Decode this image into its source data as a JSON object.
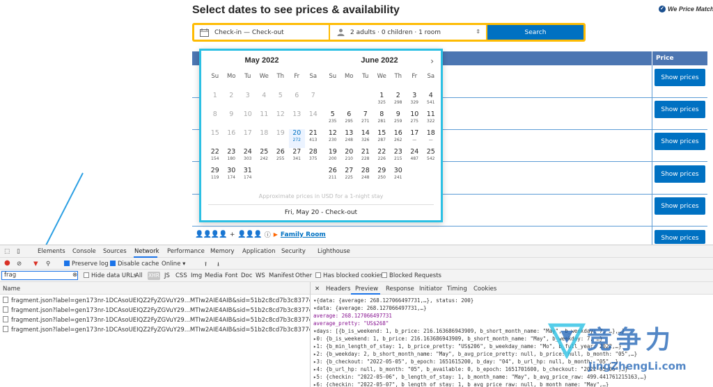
{
  "page": {
    "title": "Select dates to see prices & availability",
    "badge": "We Price Match"
  },
  "search": {
    "dates_label": "Check-in — Check-out",
    "guests_label": "2 adults · 0 children · 1 room",
    "button": "Search"
  },
  "table": {
    "price_header": "Price",
    "show_prices": [
      "Show prices",
      "Show prices",
      "Show prices",
      "Show prices",
      "Show prices",
      "Show prices"
    ],
    "family_room": "Family Room"
  },
  "calendar": {
    "day_names": [
      "Su",
      "Mo",
      "Tu",
      "We",
      "Th",
      "Fr",
      "Sa"
    ],
    "months": [
      {
        "title": "May 2022",
        "weeks": [
          [
            {
              "d": "1",
              "dis": true
            },
            {
              "d": "2",
              "dis": true
            },
            {
              "d": "3",
              "dis": true
            },
            {
              "d": "4",
              "dis": true
            },
            {
              "d": "5",
              "dis": true
            },
            {
              "d": "6",
              "dis": true
            },
            {
              "d": "7",
              "dis": true
            }
          ],
          [
            {
              "d": "8",
              "dis": true
            },
            {
              "d": "9",
              "dis": true
            },
            {
              "d": "10",
              "dis": true
            },
            {
              "d": "11",
              "dis": true
            },
            {
              "d": "12",
              "dis": true
            },
            {
              "d": "13",
              "dis": true
            },
            {
              "d": "14",
              "dis": true
            }
          ],
          [
            {
              "d": "15",
              "dis": true
            },
            {
              "d": "16",
              "dis": true
            },
            {
              "d": "17",
              "dis": true
            },
            {
              "d": "18",
              "dis": true
            },
            {
              "d": "19",
              "dis": true
            },
            {
              "d": "20",
              "p": "272",
              "sel": true
            },
            {
              "d": "21",
              "p": "413"
            }
          ],
          [
            {
              "d": "22",
              "p": "154"
            },
            {
              "d": "23",
              "p": "180"
            },
            {
              "d": "24",
              "p": "303"
            },
            {
              "d": "25",
              "p": "242"
            },
            {
              "d": "26",
              "p": "255"
            },
            {
              "d": "27",
              "p": "341"
            },
            {
              "d": "28",
              "p": "375"
            }
          ],
          [
            {
              "d": "29",
              "p": "119"
            },
            {
              "d": "30",
              "p": "174"
            },
            {
              "d": "31",
              "p": "174"
            },
            {},
            {},
            {},
            {}
          ]
        ]
      },
      {
        "title": "June 2022",
        "weeks": [
          [
            {},
            {},
            {},
            {
              "d": "1",
              "p": "325"
            },
            {
              "d": "2",
              "p": "298"
            },
            {
              "d": "3",
              "p": "329"
            },
            {
              "d": "4",
              "p": "541"
            }
          ],
          [
            {
              "d": "5",
              "p": "235"
            },
            {
              "d": "6",
              "p": "295"
            },
            {
              "d": "7",
              "p": "271"
            },
            {
              "d": "8",
              "p": "281"
            },
            {
              "d": "9",
              "p": "259"
            },
            {
              "d": "10",
              "p": "275"
            },
            {
              "d": "11",
              "p": "322"
            }
          ],
          [
            {
              "d": "12",
              "p": "230"
            },
            {
              "d": "13",
              "p": "248"
            },
            {
              "d": "14",
              "p": "326"
            },
            {
              "d": "15",
              "p": "287"
            },
            {
              "d": "16",
              "p": "262"
            },
            {
              "d": "17",
              "p": "—"
            },
            {
              "d": "18",
              "p": "—"
            }
          ],
          [
            {
              "d": "19",
              "p": "200"
            },
            {
              "d": "20",
              "p": "210"
            },
            {
              "d": "21",
              "p": "228"
            },
            {
              "d": "22",
              "p": "226"
            },
            {
              "d": "23",
              "p": "215"
            },
            {
              "d": "24",
              "p": "487"
            },
            {
              "d": "25",
              "p": "542"
            }
          ],
          [
            {
              "d": "26",
              "p": "211"
            },
            {
              "d": "27",
              "p": "225"
            },
            {
              "d": "28",
              "p": "248"
            },
            {
              "d": "29",
              "p": "250"
            },
            {
              "d": "30",
              "p": "241"
            },
            {},
            {}
          ]
        ]
      }
    ],
    "approx_note": "Approximate prices in USD for a 1-night stay",
    "footer": "Fri, May 20 - Check-out"
  },
  "devtools": {
    "tabs": [
      "Elements",
      "Console",
      "Sources",
      "Network",
      "Performance",
      "Memory",
      "Application",
      "Security",
      "Lighthouse"
    ],
    "preserve_log": "Preserve log",
    "disable_cache": "Disable cache",
    "throttle": "Online",
    "filter_value": "frag",
    "filters": [
      "Hide data URLs",
      "All",
      "XHR",
      "JS",
      "CSS",
      "Img",
      "Media",
      "Font",
      "Doc",
      "WS",
      "Manifest",
      "Other"
    ],
    "has_blocked": "Has blocked cookies",
    "blocked_requests": "Blocked Requests",
    "name_header": "Name",
    "requests": [
      "fragment.json?label=gen173nr-1DCAsoUEIQZ2FyZGVuY29...MTIw2AIE4AIB&sid=51b2c8cd7b3c8377e83692903e6f1...",
      "fragment.json?label=gen173nr-1DCAsoUEIQZ2FyZGVuY29...MTIw2AIE4AIB&sid=51b2c8cd7b3c8377e83692903e6f1...",
      "fragment.json?label=gen173nr-1DCAsoUEIQZ2FyZGVuY29...MTIw2AIE4AIB&sid=51b2c8cd7b3c8377e83692903e6f1...",
      "fragment.json?label=gen173nr-1DCAsoUEIQZ2FyZGVuY29...MTIw2AIE4AIB&sid=51b2c8cd7b3c8377e83692903e6f1..."
    ],
    "panel_tabs": [
      "Headers",
      "Preview",
      "Response",
      "Initiator",
      "Timing",
      "Cookies"
    ],
    "preview_lines": [
      "▾{data: {average: 268.127066497731,…}, status: 200}",
      "  ▾data: {average: 268.127066497731,…}",
      "      average: 268.127066497731",
      "      average_pretty: \"US$268\"",
      "    ▾days: [{b_is_weekend: 1, b_price: 216.163686943909, b_short_month_name: \"May\", b_weekday: 7, …},…]",
      "      ▸0: {b_is_weekend: 1, b_price: 216.163686943909, b_short_month_name: \"May\", b_weekday: 7, …}",
      "      ▸1: {b_min_length_of_stay: 1, b_price_pretty: \"US$206\", b_weekday_name: \"Mo\", b_full_year: 2022,…}",
      "      ▸2: {b_weekday: 2, b_short_month_name: \"May\", b_avg_price_pretty: null, b_price: null, b_month: \"05\",…}",
      "      ▸3: {b_checkout: \"2022-05-05\", b_epoch: 1651615200, b_day: \"04\", b_url_hp: null, b_month: \"05\",…}",
      "      ▸4: {b_url_hp: null, b_month: \"05\", b_available: 0, b_epoch: 1651701600, b_checkout: \"2022-05-06\",…}",
      "      ▸5: {checkin: \"2022-05-06\", b_length_of_stay: 1, b_month_name: \"May\", b_avg_price_raw: 499.441761215163,…}",
      "      ▸6: {checkin: \"2022-05-07\", b_length_of_stay: 1, b_avg_price_raw: null, b_month_name: \"May\",…}"
    ]
  },
  "watermark": {
    "text": "竞争力",
    "url": "JingZhengLi.com"
  },
  "colors": {
    "brand_blue": "#0071c2",
    "search_border": "#febb02",
    "highlight": "#2bc0e4",
    "arrow": "#2b9fe3"
  }
}
